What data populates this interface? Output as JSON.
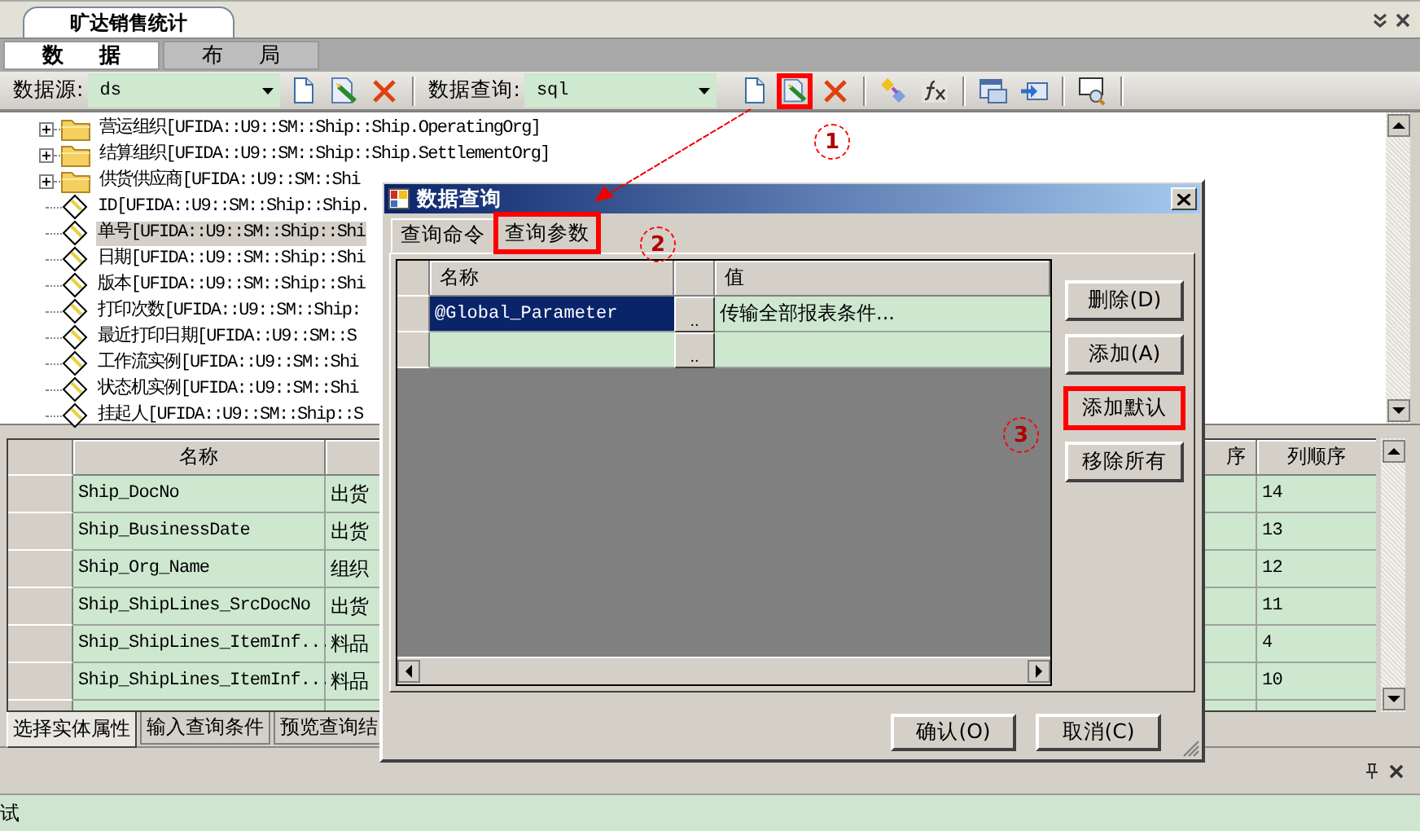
{
  "document_tab": {
    "title": "旷达销售统计"
  },
  "view_tabs": [
    {
      "label": "数据",
      "selected": true
    },
    {
      "label": "布局",
      "selected": false
    }
  ],
  "toolbar": {
    "datasource": {
      "label": "数据源:",
      "value": "ds"
    },
    "query": {
      "label": "数据查询:",
      "value": "sql"
    },
    "source_buttons": [
      {
        "kind": "new",
        "highlighted": false
      },
      {
        "kind": "edit",
        "highlighted": false
      },
      {
        "kind": "delete",
        "highlighted": false
      }
    ],
    "query_buttons": [
      {
        "kind": "new",
        "highlighted": false
      },
      {
        "kind": "edit",
        "highlighted": true
      },
      {
        "kind": "delete",
        "highlighted": false
      },
      {
        "kind": "separator"
      },
      {
        "kind": "wand",
        "highlighted": false
      },
      {
        "kind": "function",
        "highlighted": false
      },
      {
        "kind": "separator"
      },
      {
        "kind": "window",
        "highlighted": false
      },
      {
        "kind": "import",
        "highlighted": false
      },
      {
        "kind": "separator"
      },
      {
        "kind": "search",
        "highlighted": false
      },
      {
        "kind": "separator"
      }
    ]
  },
  "tree": {
    "items": [
      {
        "kind": "folder",
        "label": "营运组织[UFIDA::U9::SM::Ship::Ship.OperatingOrg]",
        "expanded": false,
        "selected": false
      },
      {
        "kind": "folder",
        "label": "结算组织[UFIDA::U9::SM::Ship::Ship.SettlementOrg]",
        "expanded": false,
        "selected": false
      },
      {
        "kind": "folder",
        "label": "供货供应商[UFIDA::U9::SM::Shi",
        "expanded": false,
        "selected": false
      },
      {
        "kind": "field",
        "label": "ID[UFIDA::U9::SM::Ship::Ship.",
        "selected": false
      },
      {
        "kind": "field",
        "label": "单号[UFIDA::U9::SM::Ship::Shi",
        "selected": true
      },
      {
        "kind": "field",
        "label": "日期[UFIDA::U9::SM::Ship::Shi",
        "selected": false
      },
      {
        "kind": "field",
        "label": "版本[UFIDA::U9::SM::Ship::Shi",
        "selected": false
      },
      {
        "kind": "field",
        "label": "打印次数[UFIDA::U9::SM::Ship:",
        "selected": false
      },
      {
        "kind": "field",
        "label": "最近打印日期[UFIDA::U9::SM::S",
        "selected": false
      },
      {
        "kind": "field",
        "label": "工作流实例[UFIDA::U9::SM::Shi",
        "selected": false
      },
      {
        "kind": "field",
        "label": "状态机实例[UFIDA::U9::SM::Shi",
        "selected": false
      },
      {
        "kind": "field",
        "label": "挂起人[UFIDA::U9::SM::Ship::S",
        "selected": false
      }
    ]
  },
  "fields_grid": {
    "columns": [
      "名称",
      "序",
      "列顺序"
    ],
    "rows": [
      {
        "name": "Ship_DocNo",
        "column_3": "出货",
        "order": "14"
      },
      {
        "name": "Ship_BusinessDate",
        "column_3": "出货",
        "order": "13"
      },
      {
        "name": "Ship_Org_Name",
        "column_3": "组织",
        "order": "12"
      },
      {
        "name": "Ship_ShipLines_SrcDocNo",
        "column_3": "出货",
        "order": "11"
      },
      {
        "name": "Ship_ShipLines_ItemInf...",
        "column_3": "料品",
        "order": "4"
      },
      {
        "name": "Ship_ShipLines_ItemInf...",
        "column_3": "料品",
        "order": "10"
      }
    ]
  },
  "bottom_tabs": [
    {
      "label": "选择实体属性",
      "selected": true
    },
    {
      "label": "输入查询条件",
      "selected": false
    },
    {
      "label": "预览查询结",
      "selected": false
    }
  ],
  "status_bar": {
    "text": "试"
  },
  "dialog": {
    "title": "数据查询",
    "tabs": [
      {
        "label": "查询命令",
        "selected": false,
        "highlighted": false
      },
      {
        "label": "查询参数",
        "selected": true,
        "highlighted": true
      }
    ],
    "grid": {
      "columns": [
        "名称",
        "值"
      ],
      "rows": [
        {
          "name": "@Global_Parameter",
          "picker": "..",
          "value": "传输全部报表条件...",
          "selected": true
        },
        {
          "picker": "..",
          "selected": false
        }
      ]
    },
    "side_buttons": [
      {
        "label": "删除(D)",
        "highlighted": false
      },
      {
        "label": "添加(A)",
        "highlighted": false
      },
      {
        "label": "添加默认",
        "highlighted": true
      },
      {
        "label": "移除所有",
        "highlighted": false
      }
    ],
    "footer_buttons": [
      {
        "label": "确认(O)"
      },
      {
        "label": "取消(C)"
      }
    ]
  },
  "annotations": [
    {
      "label": "1"
    },
    {
      "label": "2"
    },
    {
      "label": "3"
    }
  ]
}
